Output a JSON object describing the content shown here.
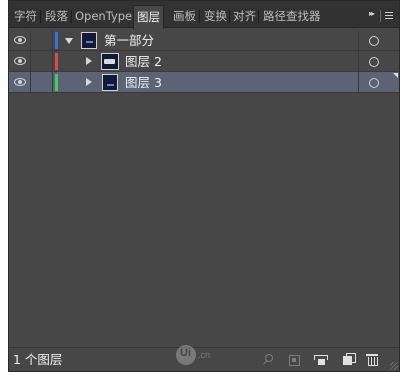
{
  "tabs": [
    {
      "label": "字符",
      "active": false
    },
    {
      "label": "段落",
      "active": false
    },
    {
      "label": "OpenType",
      "active": false
    },
    {
      "label": "图层",
      "active": true
    },
    {
      "label": "画板",
      "active": false
    },
    {
      "label": "变换",
      "active": false
    },
    {
      "label": "对齐",
      "active": false
    },
    {
      "label": "路径查找器",
      "active": false
    }
  ],
  "tabbar": {
    "collapse_glyph": "▸▸",
    "menu_icon": "panel-menu-icon"
  },
  "layers": [
    {
      "name": "第一部分",
      "expanded": true,
      "visible": true,
      "color": "#3b6fe0",
      "selected": false
    },
    {
      "name": "图层 2",
      "expanded": false,
      "visible": true,
      "color": "#e04848",
      "selected": false
    },
    {
      "name": "图层 3",
      "expanded": false,
      "visible": true,
      "color": "#3ad15a",
      "selected": true
    }
  ],
  "footer": {
    "layer_count": "1 个图层"
  },
  "icons": {
    "visibility": "eye-icon",
    "expand": "disclosure-triangle-icon",
    "target": "target-circle-icon",
    "footer": [
      "locate-object-icon",
      "clipping-mask-icon",
      "new-sublayer-icon",
      "new-layer-icon",
      "delete-icon"
    ]
  },
  "watermark": {
    "text": "Ui",
    "suffix": ".cn"
  }
}
